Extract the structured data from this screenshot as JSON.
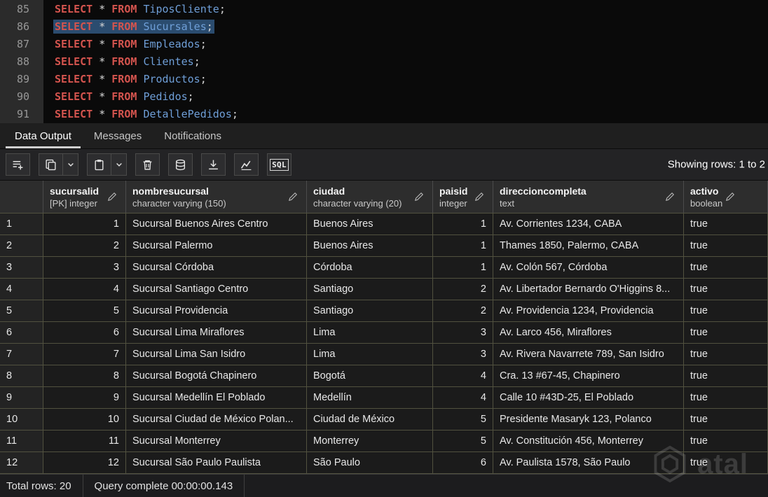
{
  "editor": {
    "lines": [
      {
        "num": "85",
        "kw1": "SELECT",
        "star": "*",
        "kw2": "FROM",
        "table": "TiposCliente",
        "semi": ";",
        "selected": false
      },
      {
        "num": "86",
        "kw1": "SELECT",
        "star": "*",
        "kw2": "FROM",
        "table": "Sucursales",
        "semi": ";",
        "selected": true
      },
      {
        "num": "87",
        "kw1": "SELECT",
        "star": "*",
        "kw2": "FROM",
        "table": "Empleados",
        "semi": ";",
        "selected": false
      },
      {
        "num": "88",
        "kw1": "SELECT",
        "star": "*",
        "kw2": "FROM",
        "table": "Clientes",
        "semi": ";",
        "selected": false
      },
      {
        "num": "89",
        "kw1": "SELECT",
        "star": "*",
        "kw2": "FROM",
        "table": "Productos",
        "semi": ";",
        "selected": false
      },
      {
        "num": "90",
        "kw1": "SELECT",
        "star": "*",
        "kw2": "FROM",
        "table": "Pedidos",
        "semi": ";",
        "selected": false
      },
      {
        "num": "91",
        "kw1": "SELECT",
        "star": "*",
        "kw2": "FROM",
        "table": "DetallePedidos",
        "semi": ";",
        "selected": false
      }
    ]
  },
  "tabs": [
    {
      "label": "Data Output",
      "active": true
    },
    {
      "label": "Messages",
      "active": false
    },
    {
      "label": "Notifications",
      "active": false
    }
  ],
  "toolbar": {
    "buttons": [
      {
        "name": "add-row-button",
        "icon": "add-row-icon",
        "dropdown": false
      },
      {
        "name": "copy-button",
        "icon": "copy-icon",
        "dropdown": true
      },
      {
        "name": "paste-button",
        "icon": "paste-icon",
        "dropdown": true
      },
      {
        "name": "delete-rows-button",
        "icon": "delete-icon",
        "dropdown": false
      },
      {
        "name": "save-data-button",
        "icon": "save-data-icon",
        "dropdown": false
      },
      {
        "name": "download-results-button",
        "icon": "download-icon",
        "dropdown": false
      },
      {
        "name": "graph-visualiser-button",
        "icon": "chart-icon",
        "dropdown": false
      },
      {
        "name": "sql-button",
        "icon": "sql-icon",
        "dropdown": false,
        "label": "SQL"
      }
    ],
    "showing_rows": "Showing rows: 1 to 2"
  },
  "grid": {
    "columns": [
      {
        "name": "sucursalid",
        "type": "[PK] integer",
        "align": "right"
      },
      {
        "name": "nombresucursal",
        "type": "character varying (150)",
        "align": "left"
      },
      {
        "name": "ciudad",
        "type": "character varying (20)",
        "align": "left"
      },
      {
        "name": "paisid",
        "type": "integer",
        "align": "right"
      },
      {
        "name": "direccioncompleta",
        "type": "text",
        "align": "left"
      },
      {
        "name": "activo",
        "type": "boolean",
        "align": "left"
      }
    ],
    "rows": [
      {
        "n": "1",
        "cells": [
          "1",
          "Sucursal Buenos Aires Centro",
          "Buenos Aires",
          "1",
          "Av. Corrientes 1234, CABA",
          "true"
        ]
      },
      {
        "n": "2",
        "cells": [
          "2",
          "Sucursal Palermo",
          "Buenos Aires",
          "1",
          "Thames 1850, Palermo, CABA",
          "true"
        ]
      },
      {
        "n": "3",
        "cells": [
          "3",
          "Sucursal Córdoba",
          "Córdoba",
          "1",
          "Av. Colón 567, Córdoba",
          "true"
        ]
      },
      {
        "n": "4",
        "cells": [
          "4",
          "Sucursal Santiago Centro",
          "Santiago",
          "2",
          "Av. Libertador Bernardo O'Higgins 8...",
          "true"
        ]
      },
      {
        "n": "5",
        "cells": [
          "5",
          "Sucursal Providencia",
          "Santiago",
          "2",
          "Av. Providencia 1234, Providencia",
          "true"
        ]
      },
      {
        "n": "6",
        "cells": [
          "6",
          "Sucursal Lima Miraflores",
          "Lima",
          "3",
          "Av. Larco 456, Miraflores",
          "true"
        ]
      },
      {
        "n": "7",
        "cells": [
          "7",
          "Sucursal Lima San Isidro",
          "Lima",
          "3",
          "Av. Rivera Navarrete 789, San Isidro",
          "true"
        ]
      },
      {
        "n": "8",
        "cells": [
          "8",
          "Sucursal Bogotá Chapinero",
          "Bogotá",
          "4",
          "Cra. 13 #67-45, Chapinero",
          "true"
        ]
      },
      {
        "n": "9",
        "cells": [
          "9",
          "Sucursal Medellín El Poblado",
          "Medellín",
          "4",
          "Calle 10 #43D-25, El Poblado",
          "true"
        ]
      },
      {
        "n": "10",
        "cells": [
          "10",
          "Sucursal Ciudad de México Polan...",
          "Ciudad de México",
          "5",
          "Presidente Masaryk 123, Polanco",
          "true"
        ]
      },
      {
        "n": "11",
        "cells": [
          "11",
          "Sucursal Monterrey",
          "Monterrey",
          "5",
          "Av. Constitución 456, Monterrey",
          "true"
        ]
      },
      {
        "n": "12",
        "cells": [
          "12",
          "Sucursal São Paulo Paulista",
          "São Paulo",
          "6",
          "Av. Paulista 1578, São Paulo",
          "true"
        ]
      }
    ]
  },
  "statusbar": {
    "total_rows": "Total rows: 20",
    "query_complete": "Query complete 00:00:00.143"
  },
  "watermark": {
    "text": "atal"
  },
  "colors": {
    "sql-keyword": "#d4544e",
    "sql-identifier": "#6f9fd8",
    "sql-plain": "#d6d6d6",
    "selection": "#2b4c6f",
    "editor-bg": "#0a0a0a",
    "gutter-bg": "#2b2b2b",
    "grid-line": "#51513f",
    "header-bg": "#2d2d2d",
    "cell-bg": "#1b1b1b",
    "rownum-bg": "#232323",
    "toolbar-bg": "#232325",
    "tab-underline": "#cfcfcf"
  }
}
